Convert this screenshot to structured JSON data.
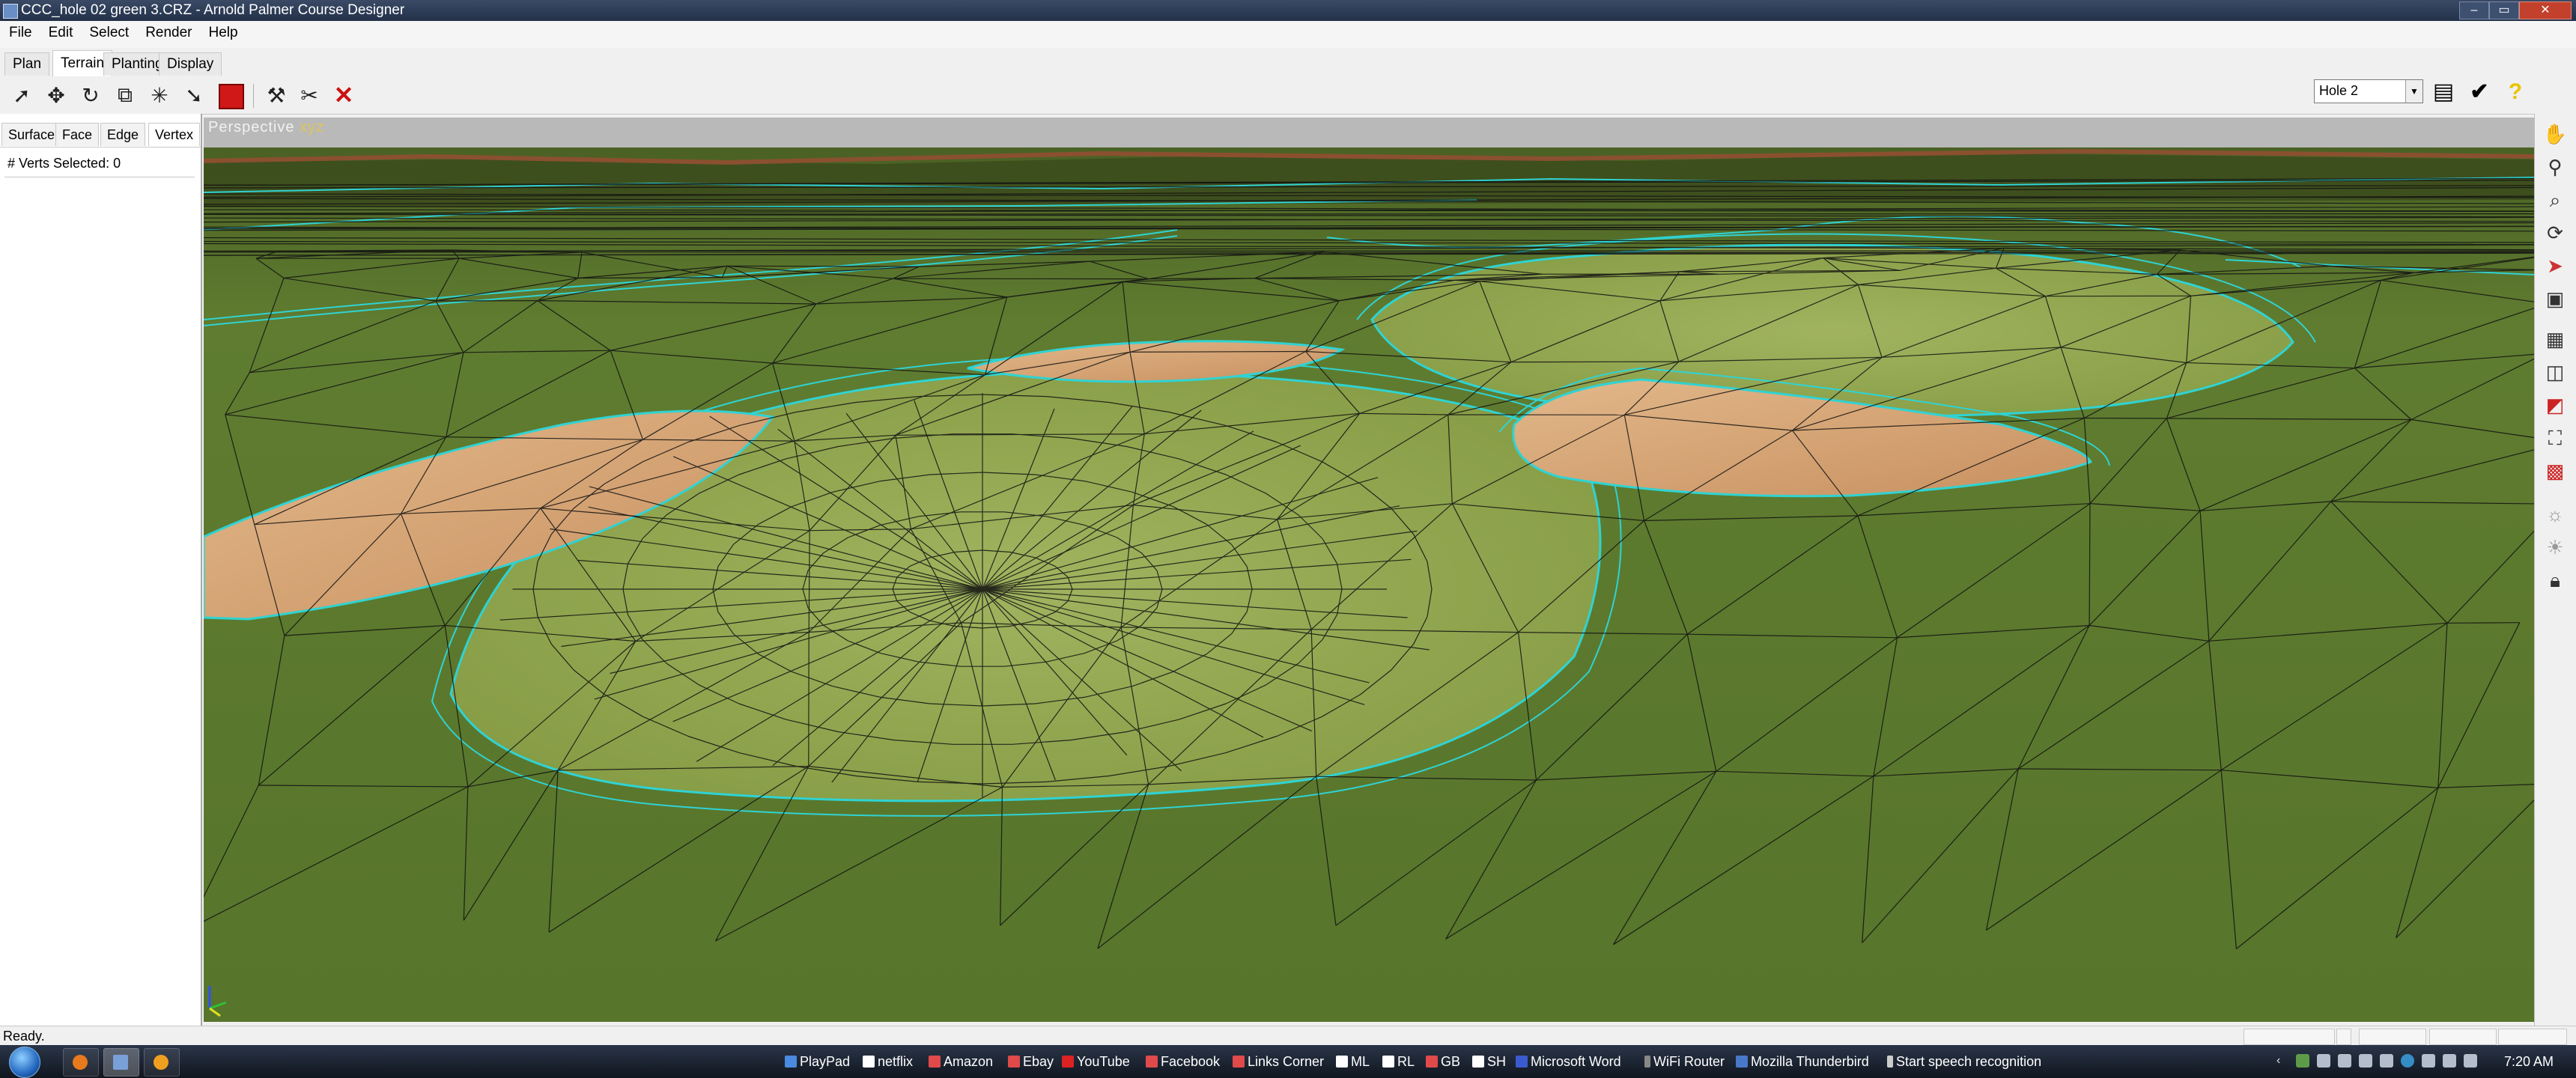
{
  "window": {
    "title": "CCC_hole 02 green 3.CRZ - Arnold Palmer Course Designer",
    "buttons": {
      "minimize": "–",
      "maximize": "▭",
      "close": "✕"
    }
  },
  "menu": [
    "File",
    "Edit",
    "Select",
    "Render",
    "Help"
  ],
  "mode_tabs": [
    {
      "label": "Plan",
      "active": false
    },
    {
      "label": "Terrain",
      "active": true
    },
    {
      "label": "Planting",
      "active": false
    },
    {
      "label": "Display",
      "active": false
    }
  ],
  "toolbar": {
    "tools": [
      "select-arrow-icon",
      "move-icon",
      "rotate-icon",
      "scale-icon",
      "split-icon",
      "pointer-add-icon",
      "fill-color-icon",
      "flatten-icon",
      "merge-icon",
      "delete-icon"
    ]
  },
  "hole_select": {
    "value": "Hole 2"
  },
  "right_tools": [
    "notes-icon",
    "check-icon",
    "help-icon"
  ],
  "left_panel": {
    "tabs": [
      {
        "label": "Surface",
        "active": false
      },
      {
        "label": "Face",
        "active": false
      },
      {
        "label": "Edge",
        "active": false
      },
      {
        "label": "Vertex",
        "active": true
      }
    ],
    "verts_selected": "# Verts Selected: 0"
  },
  "viewport": {
    "label_prefix": "Perspective ",
    "label_axes": "xyz",
    "colors": {
      "fairway": "#5b7a2e",
      "green": "#8fa84e",
      "bunker": "#d8a878",
      "outline": "#2fd3d3",
      "sky": "#b9b9b9"
    }
  },
  "view_tools": [
    "pan-hand-icon",
    "zoom-icon",
    "zoom-region-icon",
    "orbit-icon",
    "fly-icon",
    "camera-icon",
    "view-front-icon",
    "view-layout-icon",
    "view-color-icon",
    "zoom-extents-icon",
    "zoom-selected-icon",
    "light-icon",
    "light-2-icon",
    "lock-icon"
  ],
  "status": {
    "text": "Ready."
  },
  "taskbar": {
    "quick_links": [
      "PlayPad",
      "netflix",
      "Amazon",
      "Ebay",
      "YouTube",
      "Facebook",
      "Links Corner",
      "ML",
      "RL",
      "GB",
      "SH",
      "Microsoft Word",
      "WiFi Router",
      "Mozilla Thunderbird",
      "Start speech recognition"
    ],
    "clock": "7:20 AM"
  }
}
